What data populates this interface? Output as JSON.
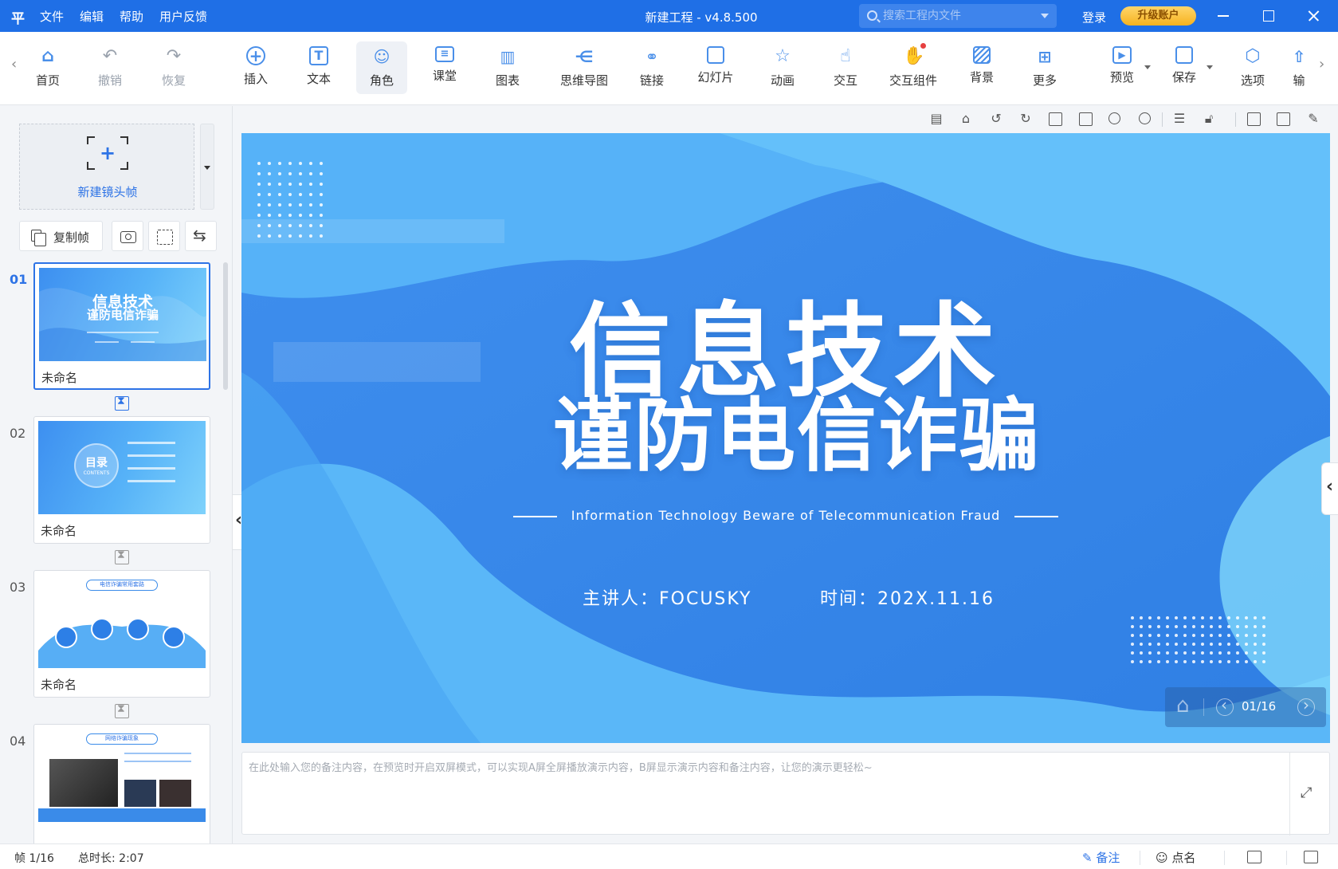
{
  "titlebar": {
    "logo": "平",
    "menu": [
      "文件",
      "编辑",
      "帮助",
      "用户反馈"
    ],
    "title": "新建工程 - v4.8.500",
    "search_placeholder": "搜索工程内文件",
    "login": "登录",
    "upgrade": "升级账户"
  },
  "toolbar": {
    "items": [
      {
        "label": "首页",
        "icon": "home-icon"
      },
      {
        "label": "撤销",
        "icon": "undo-icon"
      },
      {
        "label": "恢复",
        "icon": "redo-icon"
      },
      {
        "label": "插入",
        "icon": "plus-circle-icon"
      },
      {
        "label": "文本",
        "icon": "text-icon"
      },
      {
        "label": "角色",
        "icon": "person-icon"
      },
      {
        "label": "课堂",
        "icon": "classroom-icon"
      },
      {
        "label": "图表",
        "icon": "bar-chart-icon"
      },
      {
        "label": "思维导图",
        "icon": "mindmap-icon"
      },
      {
        "label": "链接",
        "icon": "link-icon"
      },
      {
        "label": "幻灯片",
        "icon": "slides-icon"
      },
      {
        "label": "动画",
        "icon": "star-icon"
      },
      {
        "label": "交互",
        "icon": "pointer-icon"
      },
      {
        "label": "交互组件",
        "icon": "click-icon"
      },
      {
        "label": "背景",
        "icon": "background-icon"
      },
      {
        "label": "更多",
        "icon": "grid-icon"
      },
      {
        "label": "预览",
        "icon": "play-icon"
      },
      {
        "label": "保存",
        "icon": "save-icon"
      },
      {
        "label": "选项",
        "icon": "settings-icon"
      },
      {
        "label": "输",
        "icon": "export-icon"
      }
    ]
  },
  "left_panel": {
    "new_frame_label": "新建镜头帧",
    "copy_frame_label": "复制帧",
    "slides": [
      {
        "num": "01",
        "name": "未命名",
        "thumb_line1": "信息技术",
        "thumb_line2": "谨防电信诈骗"
      },
      {
        "num": "02",
        "name": "未命名",
        "thumb_line1": "目录",
        "thumb_line2": "CONTENTS"
      },
      {
        "num": "03",
        "name": "未命名",
        "thumb_line1": "电信诈骗常用套路",
        "thumb_line2": ""
      },
      {
        "num": "04",
        "name": "",
        "thumb_line1": "网络诈骗现象",
        "thumb_line2": ""
      }
    ]
  },
  "slide": {
    "title_line1": "信息技术",
    "title_line2": "谨防电信诈骗",
    "subtitle": "Information Technology Beware of Telecommunication Fraud",
    "presenter": "主讲人：FOCUSKY",
    "date": "时间：202X.11.16",
    "page_counter": "01/16"
  },
  "notes": {
    "placeholder": "在此处输入您的备注内容，在预览时开启双屏模式，可以实现A屏全屏播放演示内容，B屏显示演示内容和备注内容，让您的演示更轻松~"
  },
  "statusbar": {
    "frame": "帧 1/16",
    "duration": "总时长: 2:07",
    "notes_label": "备注",
    "rollcall_label": "点名"
  },
  "colors": {
    "titlebar": "#1f6fe6",
    "accent": "#2d73e6",
    "slide_bg": "#3a8be9",
    "upgrade": "#f6b21f"
  }
}
